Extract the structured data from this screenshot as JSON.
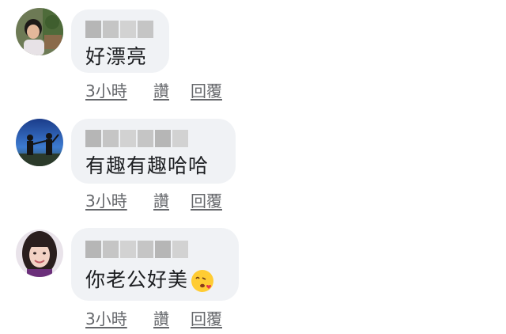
{
  "comments": [
    {
      "text": "好漂亮",
      "actions": {
        "time": "3小時",
        "like": "讚",
        "reply": "回覆"
      }
    },
    {
      "text": "有趣有趣哈哈",
      "actions": {
        "time": "3小時",
        "like": "讚",
        "reply": "回覆"
      }
    },
    {
      "text": "你老公好美",
      "emoji": "kissing-heart-emoji",
      "actions": {
        "time": "3小時",
        "like": "讚",
        "reply": "回覆"
      }
    }
  ],
  "colors": {
    "bubble": "#f0f2f5",
    "text": "#1c1e21",
    "meta": "#65676b"
  }
}
